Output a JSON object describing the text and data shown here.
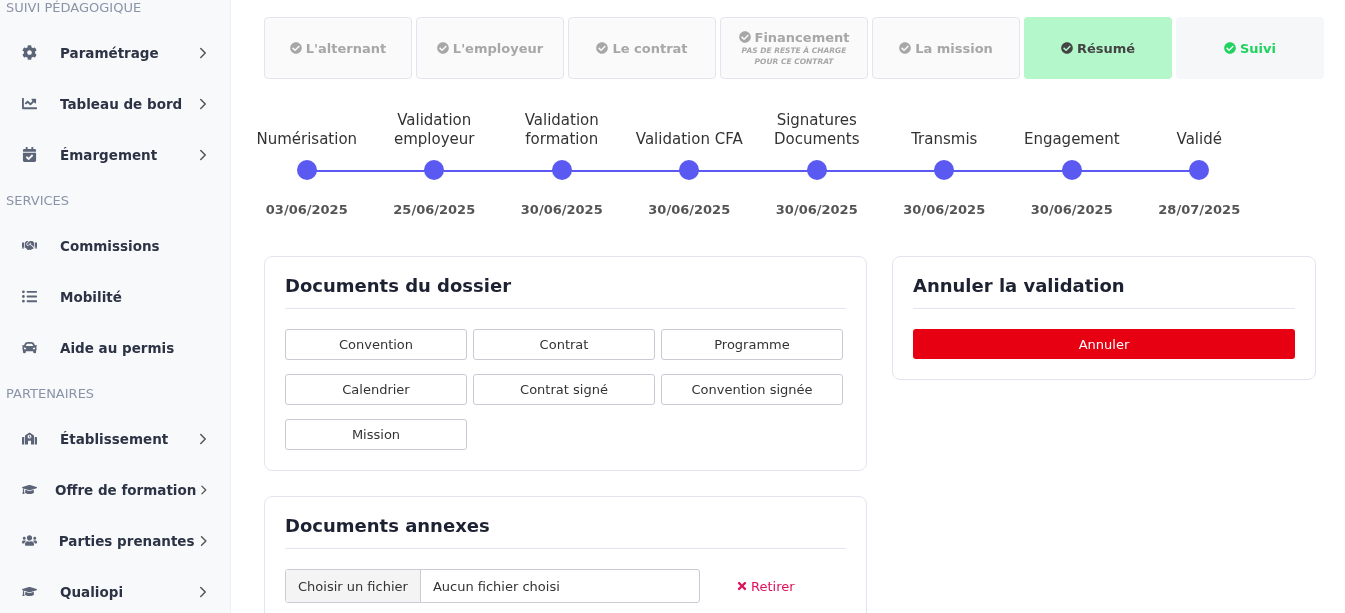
{
  "sidebar": {
    "sections": [
      {
        "title": "SUIVI PÉDAGOGIQUE",
        "items": [
          {
            "label": "Paramétrage",
            "expandable": true
          },
          {
            "label": "Tableau de bord",
            "expandable": true
          },
          {
            "label": "Émargement",
            "expandable": true
          }
        ]
      },
      {
        "title": "SERVICES",
        "items": [
          {
            "label": "Commissions",
            "expandable": false
          },
          {
            "label": "Mobilité",
            "expandable": false
          },
          {
            "label": "Aide au permis",
            "expandable": false
          }
        ]
      },
      {
        "title": "PARTENAIRES",
        "items": [
          {
            "label": "Établissement",
            "expandable": true
          },
          {
            "label": "Offre de formation",
            "expandable": true
          },
          {
            "label": "Parties prenantes",
            "expandable": true
          },
          {
            "label": "Qualiopi",
            "expandable": true
          }
        ]
      }
    ]
  },
  "steps": [
    {
      "label": "L'alternant",
      "kind": "done",
      "selected": false
    },
    {
      "label": "L'employeur",
      "kind": "done",
      "selected": false
    },
    {
      "label": "Le contrat",
      "kind": "done",
      "selected": false
    },
    {
      "label": "Financement",
      "note": "PAS DE RESTE À CHARGE POUR CE CONTRAT",
      "kind": "done",
      "selected": false
    },
    {
      "label": "La mission",
      "kind": "done",
      "selected": false
    },
    {
      "label": "Résumé",
      "kind": "done",
      "selected": true
    },
    {
      "label": "Suivi",
      "kind": "complete",
      "selected": false
    }
  ],
  "timeline": [
    {
      "label": "Numérisation",
      "date": "03/06/2025"
    },
    {
      "label": "Validation employeur",
      "date": "25/06/2025"
    },
    {
      "label": "Validation formation",
      "date": "30/06/2025"
    },
    {
      "label": "Validation CFA",
      "date": "30/06/2025"
    },
    {
      "label": "Signatures Documents",
      "date": "30/06/2025"
    },
    {
      "label": "Transmis",
      "date": "30/06/2025"
    },
    {
      "label": "Engagement",
      "date": "30/06/2025"
    },
    {
      "label": "Validé",
      "date": "28/07/2025"
    }
  ],
  "documents": {
    "title": "Documents du dossier",
    "buttons": [
      "Convention",
      "Contrat",
      "Programme",
      "Calendrier",
      "Contrat signé",
      "Convention signée",
      "Mission"
    ]
  },
  "cancel": {
    "title": "Annuler la validation",
    "button": "Annuler"
  },
  "annexes": {
    "title": "Documents annexes",
    "file_button": "Choisir un fichier",
    "file_value": "Aucun fichier choisi",
    "remove": "Retirer"
  }
}
